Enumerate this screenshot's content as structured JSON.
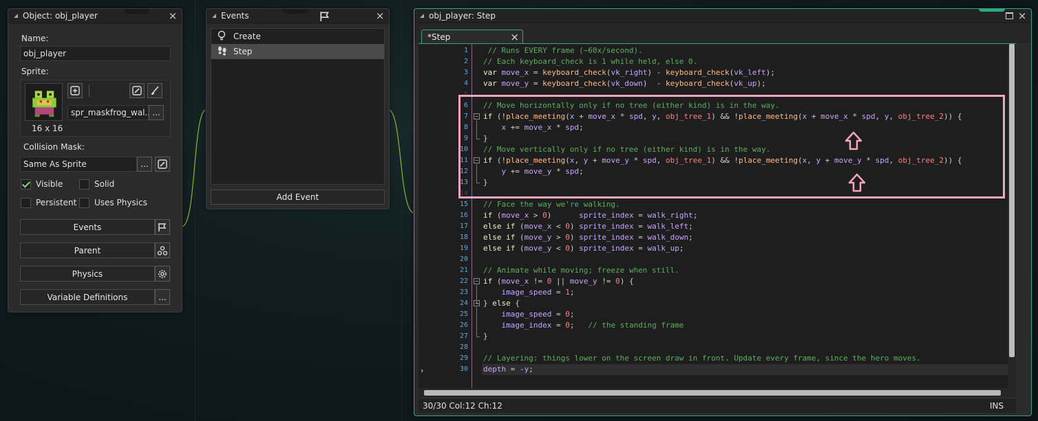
{
  "object_window": {
    "title": "Object: obj_player",
    "name_label": "Name:",
    "name_value": "obj_player",
    "sprite_label": "Sprite:",
    "sprite_name": "spr_maskfrog_wal...",
    "sprite_size": "16 x 16",
    "collision_label": "Collision Mask:",
    "collision_value": "Same As Sprite",
    "more_button": "...",
    "checkboxes": [
      {
        "label": "Visible",
        "checked": true
      },
      {
        "label": "Solid",
        "checked": false
      },
      {
        "label": "Persistent",
        "checked": false
      },
      {
        "label": "Uses Physics",
        "checked": false
      }
    ],
    "buttons": {
      "events": "Events",
      "parent": "Parent",
      "physics": "Physics",
      "variables": "Variable Definitions"
    }
  },
  "events_window": {
    "title": "Events",
    "items": [
      {
        "label": "Create",
        "icon": "lightbulb-icon",
        "selected": false
      },
      {
        "label": "Step",
        "icon": "footsteps-icon",
        "selected": true
      }
    ],
    "add_event": "Add Event"
  },
  "code_window": {
    "title": "obj_player: Step",
    "tab_label": "*Step",
    "status": "30/30 Col:12 Ch:12",
    "mode": "INS",
    "accent_color": "#2fa889",
    "highlight_color": "#f4a6bf",
    "lines": [
      " // Runs EVERY frame (~60x/second).",
      "// Each keyboard_check is 1 while held, else 0.",
      "var move_x = keyboard_check(vk_right) - keyboard_check(vk_left);",
      "var move_y = keyboard_check(vk_down)  - keyboard_check(vk_up);",
      "",
      "// Move horizontally only if no tree (either kind) is in the way.",
      "if (!place_meeting(x + move_x * spd, y, obj_tree_1) && !place_meeting(x + move_x * spd, y, obj_tree_2)) {",
      "    x += move_x * spd;",
      "}",
      "// Move vertically only if no tree (either kind) is in the way.",
      "if (!place_meeting(x, y + move_y * spd, obj_tree_1) && !place_meeting(x, y + move_y * spd, obj_tree_2)) {",
      "    y += move_y * spd;",
      "}",
      "",
      "// Face the way we're walking.",
      "if (move_x > 0)      sprite_index = walk_right;",
      "else if (move_x < 0) sprite_index = walk_left;",
      "else if (move_y > 0) sprite_index = walk_down;",
      "else if (move_y < 0) sprite_index = walk_up;",
      "",
      "// Animate while moving; freeze when still.",
      "if (move_x != 0 || move_y != 0) {",
      "    image_speed = 1;",
      "} else {",
      "    image_speed = 0;",
      "    image_index = 0;   // the standing frame",
      "}",
      "",
      "// Layering: things lower on the screen draw in front. Update every frame, since the hero moves.",
      "depth = -y;"
    ]
  }
}
